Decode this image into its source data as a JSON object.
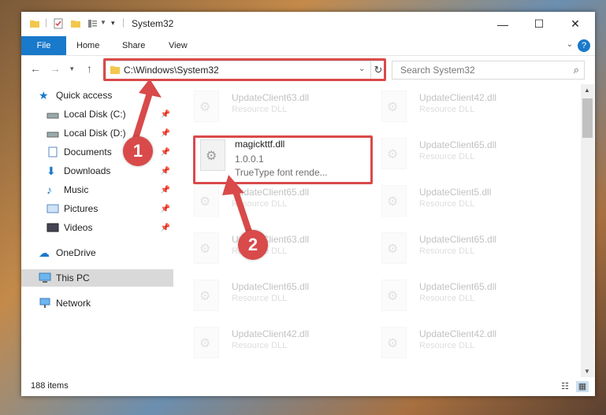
{
  "window": {
    "title": "System32",
    "controls": {
      "minimize": "—",
      "maximize": "☐",
      "close": "✕"
    }
  },
  "ribbon": {
    "file_tab": "File",
    "tabs": [
      "Home",
      "Share",
      "View"
    ],
    "help": "?"
  },
  "nav": {
    "address": "C:\\Windows\\System32",
    "search_placeholder": "Search System32"
  },
  "sidebar": {
    "items": [
      {
        "label": "Quick access",
        "icon": "star-icon",
        "pinned": false
      },
      {
        "label": "Local Disk (C:)",
        "icon": "drive-icon",
        "pinned": true
      },
      {
        "label": "Local Disk (D:)",
        "icon": "drive-icon",
        "pinned": true
      },
      {
        "label": "Documents",
        "icon": "documents-icon",
        "pinned": true
      },
      {
        "label": "Downloads",
        "icon": "download-icon",
        "pinned": true
      },
      {
        "label": "Music",
        "icon": "music-icon",
        "pinned": true
      },
      {
        "label": "Pictures",
        "icon": "pictures-icon",
        "pinned": true
      },
      {
        "label": "Videos",
        "icon": "videos-icon",
        "pinned": true
      },
      {
        "label": "OneDrive",
        "icon": "cloud-icon",
        "pinned": false
      },
      {
        "label": "This PC",
        "icon": "computer-icon",
        "pinned": false,
        "selected": true
      },
      {
        "label": "Network",
        "icon": "network-icon",
        "pinned": false
      }
    ]
  },
  "files": {
    "featured": {
      "name": "magickttf.dll",
      "version": "1.0.0.1",
      "description": "TrueType font rende..."
    },
    "left": [
      {
        "name": "UpdateClient63.dll",
        "sub": "Resource DLL"
      },
      {
        "name": "UpdateClient65.dll",
        "sub": "Resource DLL"
      },
      {
        "name": "UpdateClient63.dll",
        "sub": "Resource DLL"
      },
      {
        "name": "UpdateClient65.dll",
        "sub": "Resource DLL"
      },
      {
        "name": "UpdateClient42.dll",
        "sub": "Resource DLL"
      }
    ],
    "right": [
      {
        "name": "UpdateClient42.dll",
        "sub": "Resource DLL"
      },
      {
        "name": "UpdateClient65.dll",
        "sub": "Resource DLL"
      },
      {
        "name": "UpdateClient5.dll",
        "sub": "Resource DLL"
      },
      {
        "name": "UpdateClient65.dll",
        "sub": "Resource DLL"
      },
      {
        "name": "UpdateClient65.dll",
        "sub": "Resource DLL"
      },
      {
        "name": "UpdateClient42.dll",
        "sub": "Resource DLL"
      }
    ]
  },
  "status": {
    "item_count": "188 items"
  },
  "callouts": {
    "one": "1",
    "two": "2"
  },
  "colors": {
    "accent": "#1979ca",
    "highlight": "#d94a4a"
  }
}
